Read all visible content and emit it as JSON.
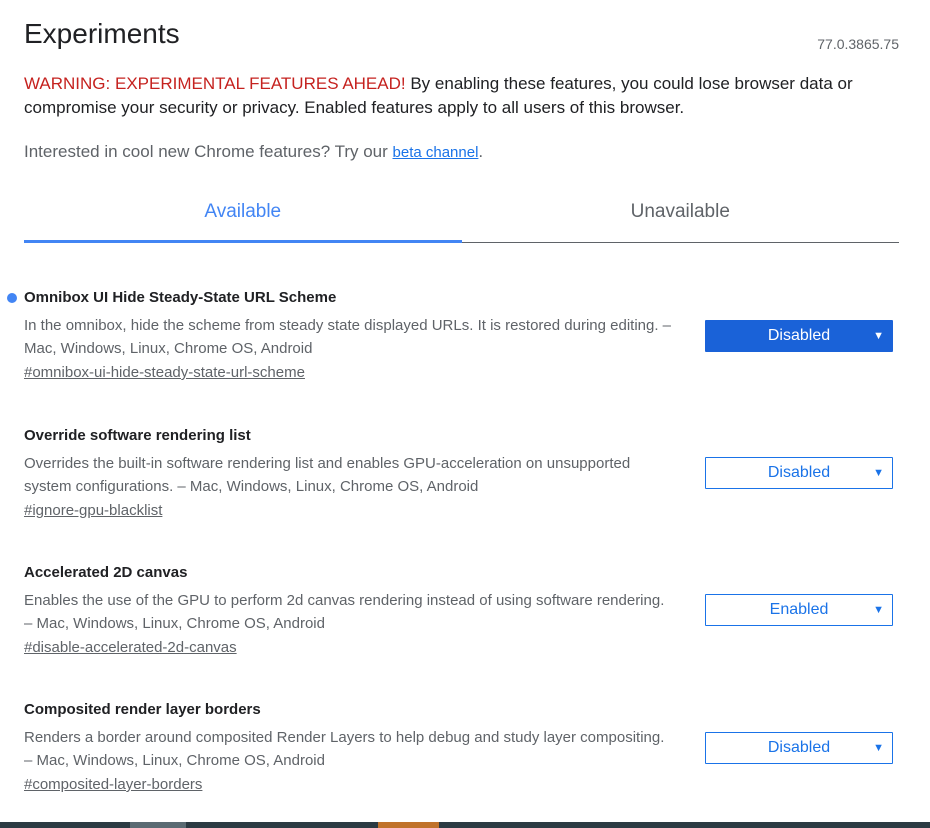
{
  "header": {
    "title": "Experiments",
    "version": "77.0.3865.75"
  },
  "warning": {
    "prefix": "WARNING: EXPERIMENTAL FEATURES AHEAD!",
    "text": " By enabling these features, you could lose browser data or compromise your security or privacy. Enabled features apply to all users of this browser."
  },
  "beta": {
    "text": "Interested in cool new Chrome features? Try our ",
    "link_label": "beta channel",
    "suffix": "."
  },
  "tabs": [
    {
      "label": "Available",
      "active": true
    },
    {
      "label": "Unavailable",
      "active": false
    }
  ],
  "experiments": [
    {
      "name": "Omnibox UI Hide Steady-State URL Scheme",
      "description": "In the omnibox, hide the scheme from steady state displayed URLs. It is restored during editing. – Mac, Windows, Linux, Chrome OS, Android",
      "link": "#omnibox-ui-hide-steady-state-url-scheme",
      "value": "Disabled",
      "highlighted": true
    },
    {
      "name": "Override software rendering list",
      "description": "Overrides the built-in software rendering list and enables GPU-acceleration on unsupported system configurations. – Mac, Windows, Linux, Chrome OS, Android",
      "link": "#ignore-gpu-blacklist",
      "value": "Disabled",
      "highlighted": false
    },
    {
      "name": "Accelerated 2D canvas",
      "description": "Enables the use of the GPU to perform 2d canvas rendering instead of using software rendering. – Mac, Windows, Linux, Chrome OS, Android",
      "link": "#disable-accelerated-2d-canvas",
      "value": "Enabled",
      "highlighted": false
    },
    {
      "name": "Composited render layer borders",
      "description": "Renders a border around composited Render Layers to help debug and study layer compositing. – Mac, Windows, Linux, Chrome OS, Android",
      "link": "#composited-layer-borders",
      "value": "Disabled",
      "highlighted": false
    }
  ],
  "icons": {
    "dropdown": "dropdown-arrow-icon",
    "modified": "modified-dot-icon"
  },
  "colors": {
    "accent": "#1a73e8",
    "tab_active": "#4285f4",
    "warning": "#c5221f"
  }
}
